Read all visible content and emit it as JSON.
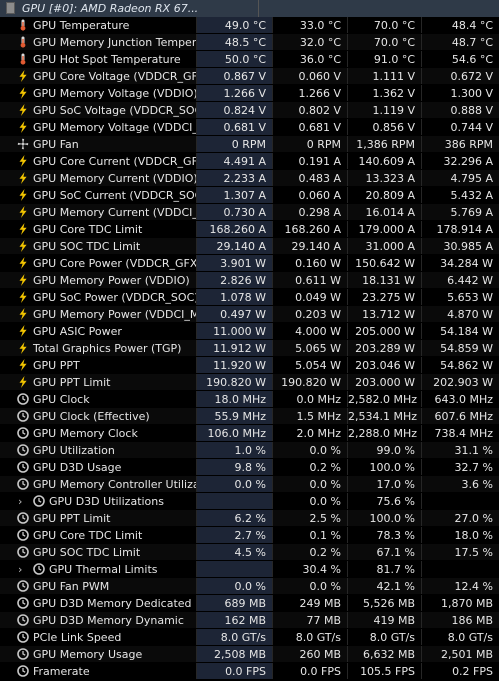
{
  "header": {
    "title": "GPU [#0]: AMD Radeon RX 67..."
  },
  "icon_colors": {
    "thermometer": "#e05a32",
    "bolt": "#f2c400",
    "clock": "#c8c8c8",
    "fan": "#c8c8c8"
  },
  "rows": [
    {
      "icon": "thermometer",
      "label": "GPU Temperature",
      "current": "49.0 °C",
      "min": "33.0 °C",
      "max": "70.0 °C",
      "avg": "48.4 °C"
    },
    {
      "icon": "thermometer",
      "label": "GPU Memory Junction Temper...",
      "current": "48.5 °C",
      "min": "32.0 °C",
      "max": "70.0 °C",
      "avg": "48.7 °C"
    },
    {
      "icon": "thermometer",
      "label": "GPU Hot Spot Temperature",
      "current": "50.0 °C",
      "min": "36.0 °C",
      "max": "91.0 °C",
      "avg": "54.6 °C"
    },
    {
      "icon": "bolt",
      "label": "GPU Core Voltage (VDDCR_GFX)",
      "current": "0.867 V",
      "min": "0.060 V",
      "max": "1.111 V",
      "avg": "0.672 V"
    },
    {
      "icon": "bolt",
      "label": "GPU Memory Voltage (VDDIO)",
      "current": "1.266 V",
      "min": "1.266 V",
      "max": "1.362 V",
      "avg": "1.300 V"
    },
    {
      "icon": "bolt",
      "label": "GPU SoC Voltage (VDDCR_SOC)",
      "current": "0.824 V",
      "min": "0.802 V",
      "max": "1.119 V",
      "avg": "0.888 V"
    },
    {
      "icon": "bolt",
      "label": "GPU Memory Voltage (VDDCI_...",
      "current": "0.681 V",
      "min": "0.681 V",
      "max": "0.856 V",
      "avg": "0.744 V"
    },
    {
      "icon": "fan",
      "label": "GPU Fan",
      "current": "0 RPM",
      "min": "0 RPM",
      "max": "1,386 RPM",
      "avg": "386 RPM"
    },
    {
      "icon": "bolt",
      "label": "GPU Core Current (VDDCR_GFX)",
      "current": "4.491 A",
      "min": "0.191 A",
      "max": "140.609 A",
      "avg": "32.296 A"
    },
    {
      "icon": "bolt",
      "label": "GPU Memory Current (VDDIO)",
      "current": "2.233 A",
      "min": "0.483 A",
      "max": "13.323 A",
      "avg": "4.795 A"
    },
    {
      "icon": "bolt",
      "label": "GPU SoC Current (VDDCR_SOC)",
      "current": "1.307 A",
      "min": "0.060 A",
      "max": "20.809 A",
      "avg": "5.432 A"
    },
    {
      "icon": "bolt",
      "label": "GPU Memory Current (VDDCI_...",
      "current": "0.730 A",
      "min": "0.298 A",
      "max": "16.014 A",
      "avg": "5.769 A"
    },
    {
      "icon": "bolt",
      "label": "GPU Core TDC Limit",
      "current": "168.260 A",
      "min": "168.260 A",
      "max": "179.000 A",
      "avg": "178.914 A"
    },
    {
      "icon": "bolt",
      "label": "GPU SOC TDC Limit",
      "current": "29.140 A",
      "min": "29.140 A",
      "max": "31.000 A",
      "avg": "30.985 A"
    },
    {
      "icon": "bolt",
      "label": "GPU Core Power (VDDCR_GFX)",
      "current": "3.901 W",
      "min": "0.160 W",
      "max": "150.642 W",
      "avg": "34.284 W"
    },
    {
      "icon": "bolt",
      "label": "GPU Memory Power (VDDIO)",
      "current": "2.826 W",
      "min": "0.611 W",
      "max": "18.131 W",
      "avg": "6.442 W"
    },
    {
      "icon": "bolt",
      "label": "GPU SoC Power (VDDCR_SOC)",
      "current": "1.078 W",
      "min": "0.049 W",
      "max": "23.275 W",
      "avg": "5.653 W"
    },
    {
      "icon": "bolt",
      "label": "GPU Memory Power (VDDCI_M...",
      "current": "0.497 W",
      "min": "0.203 W",
      "max": "13.712 W",
      "avg": "4.870 W"
    },
    {
      "icon": "bolt",
      "label": "GPU ASIC Power",
      "current": "11.000 W",
      "min": "4.000 W",
      "max": "205.000 W",
      "avg": "54.184 W"
    },
    {
      "icon": "bolt",
      "label": "Total Graphics Power (TGP)",
      "current": "11.912 W",
      "min": "5.065 W",
      "max": "203.289 W",
      "avg": "54.859 W"
    },
    {
      "icon": "bolt",
      "label": "GPU PPT",
      "current": "11.920 W",
      "min": "5.054 W",
      "max": "203.046 W",
      "avg": "54.862 W"
    },
    {
      "icon": "bolt",
      "label": "GPU PPT Limit",
      "current": "190.820 W",
      "min": "190.820 W",
      "max": "203.000 W",
      "avg": "202.903 W"
    },
    {
      "icon": "clock",
      "label": "GPU Clock",
      "current": "18.0 MHz",
      "min": "0.0 MHz",
      "max": "2,582.0 MHz",
      "avg": "643.0 MHz"
    },
    {
      "icon": "clock",
      "label": "GPU Clock (Effective)",
      "current": "55.9 MHz",
      "min": "1.5 MHz",
      "max": "2,534.1 MHz",
      "avg": "607.6 MHz"
    },
    {
      "icon": "clock",
      "label": "GPU Memory Clock",
      "current": "106.0 MHz",
      "min": "2.0 MHz",
      "max": "2,288.0 MHz",
      "avg": "738.4 MHz"
    },
    {
      "icon": "clock",
      "label": "GPU Utilization",
      "current": "1.0 %",
      "min": "0.0 %",
      "max": "99.0 %",
      "avg": "31.1 %"
    },
    {
      "icon": "clock",
      "label": "GPU D3D Usage",
      "current": "9.8 %",
      "min": "0.2 %",
      "max": "100.0 %",
      "avg": "32.7 %"
    },
    {
      "icon": "clock",
      "label": "GPU Memory Controller Utilization",
      "current": "0.0 %",
      "min": "0.0 %",
      "max": "17.0 %",
      "avg": "3.6 %"
    },
    {
      "icon": "clock",
      "label": "GPU D3D Utilizations",
      "current": "",
      "min": "0.0 %",
      "max": "75.6 %",
      "avg": "",
      "expandable": true
    },
    {
      "icon": "clock",
      "label": "GPU PPT Limit",
      "current": "6.2 %",
      "min": "2.5 %",
      "max": "100.0 %",
      "avg": "27.0 %"
    },
    {
      "icon": "clock",
      "label": "GPU Core TDC Limit",
      "current": "2.7 %",
      "min": "0.1 %",
      "max": "78.3 %",
      "avg": "18.0 %"
    },
    {
      "icon": "clock",
      "label": "GPU SOC TDC Limit",
      "current": "4.5 %",
      "min": "0.2 %",
      "max": "67.1 %",
      "avg": "17.5 %"
    },
    {
      "icon": "clock",
      "label": "GPU Thermal Limits",
      "current": "",
      "min": "30.4 %",
      "max": "81.7 %",
      "avg": "",
      "expandable": true
    },
    {
      "icon": "clock",
      "label": "GPU Fan PWM",
      "current": "0.0 %",
      "min": "0.0 %",
      "max": "42.1 %",
      "avg": "12.4 %"
    },
    {
      "icon": "clock",
      "label": "GPU D3D Memory Dedicated",
      "current": "689 MB",
      "min": "249 MB",
      "max": "5,526 MB",
      "avg": "1,870 MB"
    },
    {
      "icon": "clock",
      "label": "GPU D3D Memory Dynamic",
      "current": "162 MB",
      "min": "77 MB",
      "max": "419 MB",
      "avg": "186 MB"
    },
    {
      "icon": "clock",
      "label": "PCIe Link Speed",
      "current": "8.0 GT/s",
      "min": "8.0 GT/s",
      "max": "8.0 GT/s",
      "avg": "8.0 GT/s"
    },
    {
      "icon": "clock",
      "label": "GPU Memory Usage",
      "current": "2,508 MB",
      "min": "260 MB",
      "max": "6,632 MB",
      "avg": "2,501 MB"
    },
    {
      "icon": "clock",
      "label": "Framerate",
      "current": "0.0 FPS",
      "min": "0.0 FPS",
      "max": "105.5 FPS",
      "avg": "0.2 FPS"
    }
  ]
}
